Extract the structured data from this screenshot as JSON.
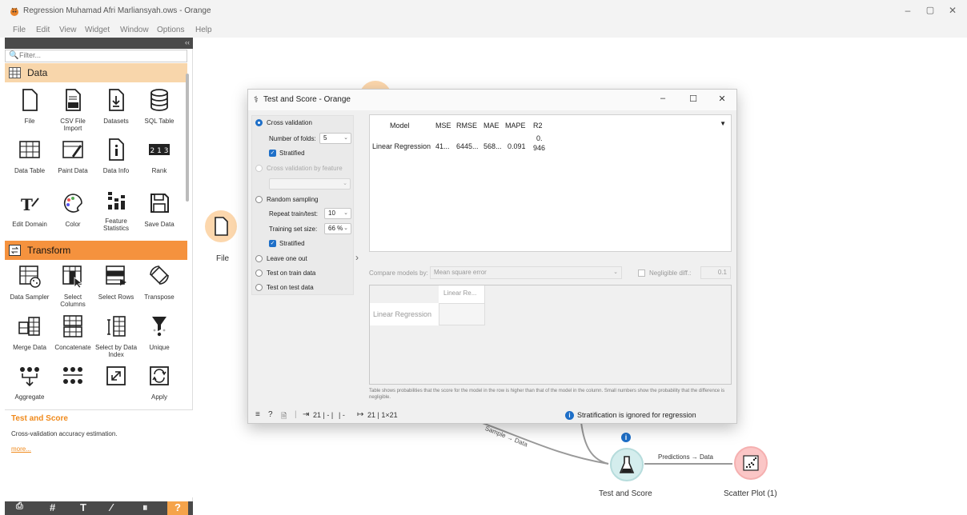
{
  "window": {
    "title": "Regression Muhamad Afri Marliansyah.ows - Orange",
    "controls": {
      "minimize": "–",
      "restore": "▢",
      "close": "✕"
    }
  },
  "menu": [
    "File",
    "Edit",
    "View",
    "Widget",
    "Window",
    "Options",
    "Help"
  ],
  "panel": {
    "collapse": "‹‹",
    "filter_placeholder": "Filter...",
    "categories": {
      "data": "Data",
      "transform": "Transform"
    },
    "data_widgets": [
      "File",
      "CSV File Import",
      "Datasets",
      "SQL Table",
      "Data Table",
      "Paint Data",
      "Data Info",
      "Rank",
      "Edit Domain",
      "Color",
      "Feature Statistics",
      "Save Data"
    ],
    "transform_widgets": [
      "Data Sampler",
      "Select Columns",
      "Select Rows",
      "Transpose",
      "Merge Data",
      "Concatenate",
      "Select by Data Index",
      "Unique",
      "Aggregate",
      "",
      "",
      "Apply"
    ],
    "description": {
      "title": "Test and Score",
      "text": "Cross-validation accuracy estimation.",
      "more": "more..."
    },
    "toolbar": [
      "⎙",
      "#",
      "T",
      "⁄",
      "⏸",
      "?"
    ]
  },
  "canvas": {
    "file_label": "File",
    "test_label": "Test and Score",
    "scatter_label": "Scatter Plot (1)",
    "link_predictions": "Predictions → Data",
    "link_sample": "Sample → Data",
    "rank_glyph": "2 1 3"
  },
  "dialog": {
    "title": "Test and Score - Orange",
    "controls": {
      "minimize": "–",
      "maximize": "☐",
      "close": "✕"
    },
    "sampling": {
      "cross_validation": "Cross validation",
      "folds_label": "Number of folds:",
      "folds_value": "5",
      "stratified": "Stratified",
      "cv_by_feature": "Cross validation by feature",
      "random_sampling": "Random sampling",
      "repeat_label": "Repeat train/test:",
      "repeat_value": "10",
      "train_size_label": "Training set size:",
      "train_size_value": "66 %",
      "stratified2": "Stratified",
      "leave_one_out": "Leave one out",
      "test_train": "Test on train data",
      "test_test": "Test on test data"
    },
    "results": {
      "headers": [
        "Model",
        "MSE",
        "RMSE",
        "MAE",
        "MAPE",
        "R2"
      ],
      "rows": [
        {
          "model": "Linear Regression",
          "mse": "41...",
          "rmse": "6445...",
          "mae": "568...",
          "mape": "0.091",
          "r2_a": "0.",
          "r2_b": "946"
        }
      ]
    },
    "compare": {
      "label": "Compare models by:",
      "value": "Mean square error",
      "negligible": "Negligible diff.:",
      "negligible_value": "0.1",
      "col_header": "Linear Re...",
      "row_header": "Linear Regression",
      "footnote": "Table shows probabilities that the score for the model in the row is higher than that of the model in the column. Small numbers show the probability that the difference is negligible."
    },
    "status": {
      "input": "21 | - |",
      "input2": "| -",
      "output": "21 | 1×21",
      "info": "Stratification is ignored for regression"
    }
  }
}
